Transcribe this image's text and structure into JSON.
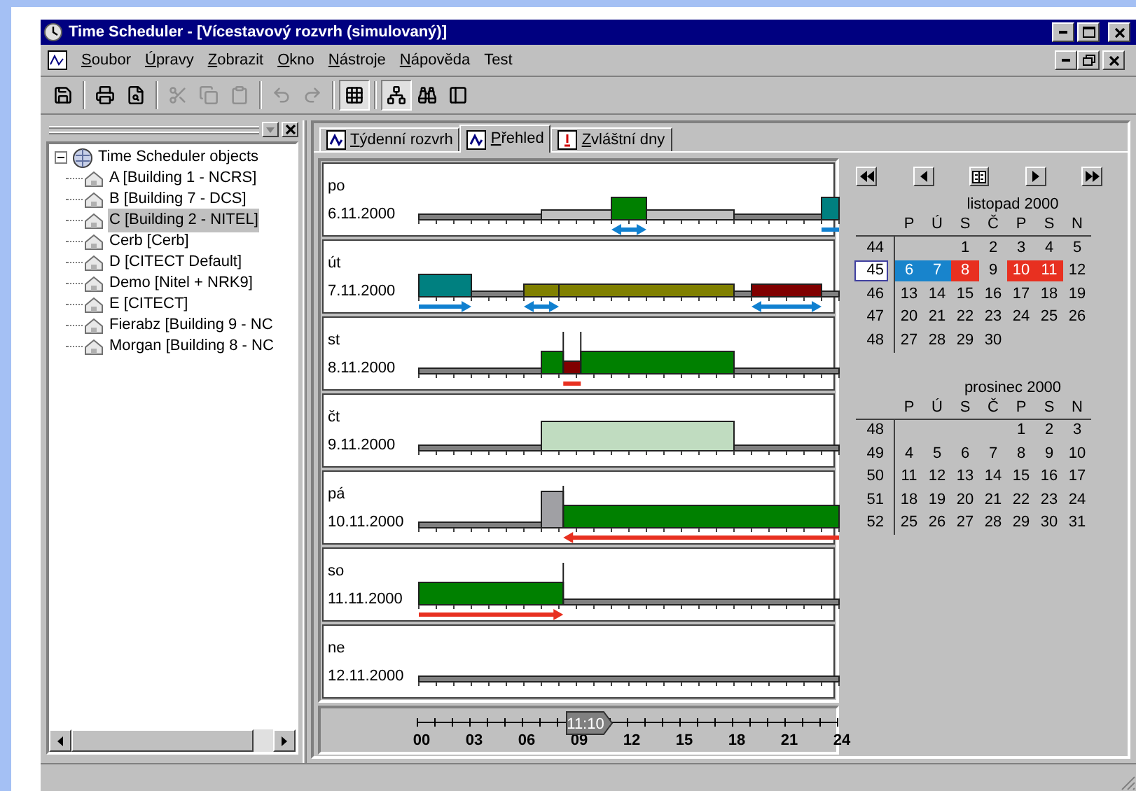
{
  "window": {
    "title": "Time Scheduler - [Vícestavový rozvrh (simulovaný)]"
  },
  "menu": [
    {
      "label": "Soubor",
      "underline": true
    },
    {
      "label": "Úpravy",
      "underline": true
    },
    {
      "label": "Zobrazit",
      "underline": true
    },
    {
      "label": "Okno",
      "underline": true
    },
    {
      "label": "Nástroje",
      "underline": true
    },
    {
      "label": "Nápověda",
      "underline": true
    },
    {
      "label": "Test",
      "underline": false
    }
  ],
  "toolbar": [
    [
      {
        "kind": "save",
        "disabled": false,
        "pressed": false
      }
    ],
    [
      {
        "kind": "print",
        "disabled": false,
        "pressed": false
      },
      {
        "kind": "preview",
        "disabled": false,
        "pressed": false
      }
    ],
    [
      {
        "kind": "cut",
        "disabled": true,
        "pressed": false
      },
      {
        "kind": "copy",
        "disabled": true,
        "pressed": false
      },
      {
        "kind": "paste",
        "disabled": true,
        "pressed": false
      }
    ],
    [
      {
        "kind": "undo",
        "disabled": true,
        "pressed": false
      },
      {
        "kind": "redo",
        "disabled": true,
        "pressed": false
      }
    ],
    [
      {
        "kind": "grid",
        "disabled": false,
        "pressed": true
      }
    ],
    [
      {
        "kind": "tree",
        "disabled": false,
        "pressed": true
      },
      {
        "kind": "find",
        "disabled": false,
        "pressed": false
      },
      {
        "kind": "special",
        "disabled": false,
        "pressed": false
      }
    ]
  ],
  "tree": {
    "label": "Time Scheduler objects",
    "expanded": true,
    "children": [
      {
        "label": "A [Building 1 - NCRS]",
        "selected": false
      },
      {
        "label": "B [Building 7 - DCS]",
        "selected": false
      },
      {
        "label": "C [Building 2 - NITEL]",
        "selected": true
      },
      {
        "label": "Cerb [Cerb]",
        "selected": false
      },
      {
        "label": "D [CITECT Default]",
        "selected": false
      },
      {
        "label": "Demo [Nitel + NRK9]",
        "selected": false
      },
      {
        "label": "E [CITECT]",
        "selected": false
      },
      {
        "label": "Fierabz [Building 9 - NC",
        "selected": false
      },
      {
        "label": "Morgan [Building 8 - NC",
        "selected": false
      }
    ]
  },
  "tabs": [
    {
      "label": "Týdenní rozvrh",
      "selected": false
    },
    {
      "label": "Přehled",
      "selected": true
    },
    {
      "label": "Zvláštní dny",
      "selected": false
    }
  ],
  "days": [
    {
      "name": "po",
      "date": "6.11.2000"
    },
    {
      "name": "út",
      "date": "7.11.2000"
    },
    {
      "name": "st",
      "date": "8.11.2000"
    },
    {
      "name": "čt",
      "date": "9.11.2000"
    },
    {
      "name": "pá",
      "date": "10.11.2000"
    },
    {
      "name": "so",
      "date": "11.11.2000"
    },
    {
      "name": "ne",
      "date": "12.11.2000"
    }
  ],
  "time_axis": {
    "labels": [
      "00",
      "03",
      "06",
      "09",
      "12",
      "15",
      "18",
      "21",
      "24"
    ],
    "marker": {
      "label": "11:10"
    }
  },
  "calendar": {
    "months": [
      {
        "title": "listopad 2000",
        "headers": [
          "P",
          "Ú",
          "S",
          "Č",
          "P",
          "S",
          "N"
        ],
        "weeks": [
          {
            "week": "44",
            "selected": false,
            "days": [
              {
                "text": "1"
              },
              {
                "text": "2"
              },
              {
                "text": "3"
              },
              {
                "text": "4"
              },
              {
                "text": "5"
              }
            ]
          },
          {
            "week": "45",
            "selected": true,
            "days": [
              {
                "text": "6",
                "color": "#1884cc"
              },
              {
                "text": "7",
                "color": "#1884cc"
              },
              {
                "text": "8",
                "color": "#e83020"
              },
              {
                "text": "9"
              },
              {
                "text": "10",
                "color": "#e83020"
              },
              {
                "text": "11",
                "color": "#e83020"
              },
              {
                "text": "12"
              }
            ]
          },
          {
            "week": "46",
            "selected": false,
            "days": [
              {
                "text": "13"
              },
              {
                "text": "14"
              },
              {
                "text": "15"
              },
              {
                "text": "16"
              },
              {
                "text": "17"
              },
              {
                "text": "18"
              },
              {
                "text": "19"
              }
            ]
          },
          {
            "week": "47",
            "selected": false,
            "days": [
              {
                "text": "20"
              },
              {
                "text": "21"
              },
              {
                "text": "22"
              },
              {
                "text": "23"
              },
              {
                "text": "24"
              },
              {
                "text": "25"
              },
              {
                "text": "26"
              }
            ]
          },
          {
            "week": "48",
            "selected": false,
            "days": [
              {
                "text": "27"
              },
              {
                "text": "28"
              },
              {
                "text": "29"
              },
              {
                "text": "30"
              }
            ]
          }
        ]
      },
      {
        "title": "prosinec 2000",
        "headers": [
          "P",
          "Ú",
          "S",
          "Č",
          "P",
          "S",
          "N"
        ],
        "weeks": [
          {
            "week": "48",
            "selected": false,
            "days": [
              {
                "text": "1"
              },
              {
                "text": "2"
              },
              {
                "text": "3"
              }
            ]
          },
          {
            "week": "49",
            "selected": false,
            "days": [
              {
                "text": "4"
              },
              {
                "text": "5"
              },
              {
                "text": "6"
              },
              {
                "text": "7"
              },
              {
                "text": "8"
              },
              {
                "text": "9"
              },
              {
                "text": "10"
              }
            ]
          },
          {
            "week": "50",
            "selected": false,
            "days": [
              {
                "text": "11"
              },
              {
                "text": "12"
              },
              {
                "text": "13"
              },
              {
                "text": "14"
              },
              {
                "text": "15"
              },
              {
                "text": "16"
              },
              {
                "text": "17"
              }
            ]
          },
          {
            "week": "51",
            "selected": false,
            "days": [
              {
                "text": "18"
              },
              {
                "text": "19"
              },
              {
                "text": "20"
              },
              {
                "text": "21"
              },
              {
                "text": "22"
              },
              {
                "text": "23"
              },
              {
                "text": "24"
              }
            ]
          },
          {
            "week": "52",
            "selected": false,
            "days": [
              {
                "text": "25"
              },
              {
                "text": "26"
              },
              {
                "text": "27"
              },
              {
                "text": "28"
              },
              {
                "text": "29"
              },
              {
                "text": "30"
              },
              {
                "text": "31"
              }
            ]
          }
        ]
      }
    ]
  }
}
